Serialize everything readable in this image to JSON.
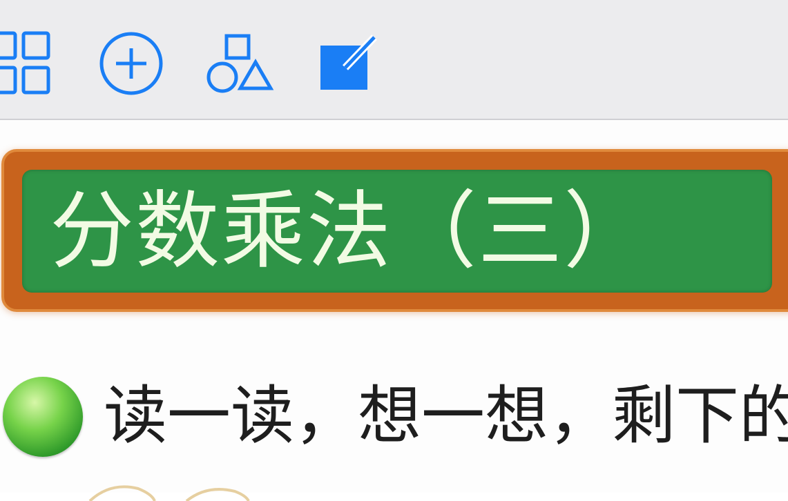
{
  "toolbar": {
    "icons": [
      {
        "name": "grid-view-icon"
      },
      {
        "name": "add-circle-icon"
      },
      {
        "name": "shapes-icon"
      },
      {
        "name": "compose-icon"
      }
    ],
    "accent_color": "#1a7ef5"
  },
  "lesson": {
    "title": "分数乘法（三）",
    "board_frame_color": "#c8631d",
    "board_color": "#2e9447",
    "instruction": "读一读，想一想，剩下的"
  }
}
